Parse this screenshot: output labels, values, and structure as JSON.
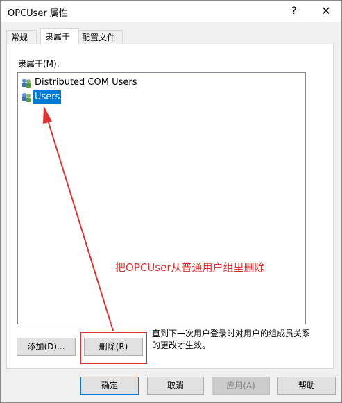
{
  "window": {
    "title": "OPCUser 属性",
    "help_button": "?",
    "close_button": "✕"
  },
  "tabs": [
    {
      "label": "常规",
      "active": false
    },
    {
      "label": "隶属于",
      "active": true
    },
    {
      "label": "配置文件",
      "active": false
    }
  ],
  "member_of": {
    "label": "隶属于(M):",
    "items": [
      {
        "label": "Distributed COM Users",
        "selected": false,
        "icon": "group-icon"
      },
      {
        "label": "Users",
        "selected": true,
        "icon": "group-icon"
      }
    ]
  },
  "actions": {
    "add_label": "添加(D)...",
    "remove_label": "删除(R)",
    "note": "直到下一次用户登录时对用户的组成员关系的更改才生效。"
  },
  "footer": {
    "ok_label": "确定",
    "cancel_label": "取消",
    "apply_label": "应用(A)",
    "help_label": "帮助"
  },
  "annotation": {
    "text": "把OPCUser从普通用户组里删除",
    "color": "#e03030"
  },
  "colors": {
    "selection": "#0078d7",
    "annotation": "#e03030"
  }
}
